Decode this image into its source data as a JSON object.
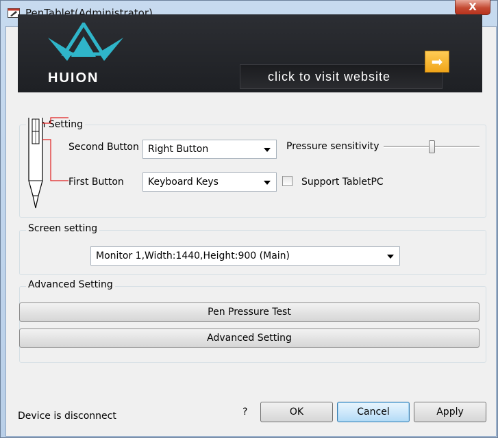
{
  "window": {
    "title": "PenTablet(Administrator)",
    "close_glyph": "X"
  },
  "banner": {
    "brand": "HUION",
    "visit_label": "click to visit website",
    "arrow_glyph": "➡"
  },
  "pen_setting": {
    "group_label": "Pen Setting",
    "second_button_label": "Second Button",
    "second_button_value": "Right Button",
    "first_button_label": "First Button",
    "first_button_value": "Keyboard Keys",
    "pressure_label": "Pressure sensitivity",
    "pressure_level": 0.5,
    "support_tabletpc_label": "Support TabletPC",
    "support_tabletpc_checked": false
  },
  "screen_setting": {
    "group_label": "Screen setting",
    "monitor_value": "Monitor 1,Width:1440,Height:900 (Main)"
  },
  "advanced_setting": {
    "group_label": "Advanced Setting",
    "pen_pressure_test_label": "Pen Pressure Test",
    "advanced_setting_button_label": "Advanced Setting"
  },
  "footer": {
    "status": "Device is disconnect",
    "help": "?",
    "ok": "OK",
    "cancel": "Cancel",
    "apply": "Apply"
  },
  "colors": {
    "banner_bg": "#2c2e33",
    "logo_teal": "#2fb5c9",
    "arrow_orange": "#f0a51a",
    "pen_callout_red": "#e02020"
  }
}
